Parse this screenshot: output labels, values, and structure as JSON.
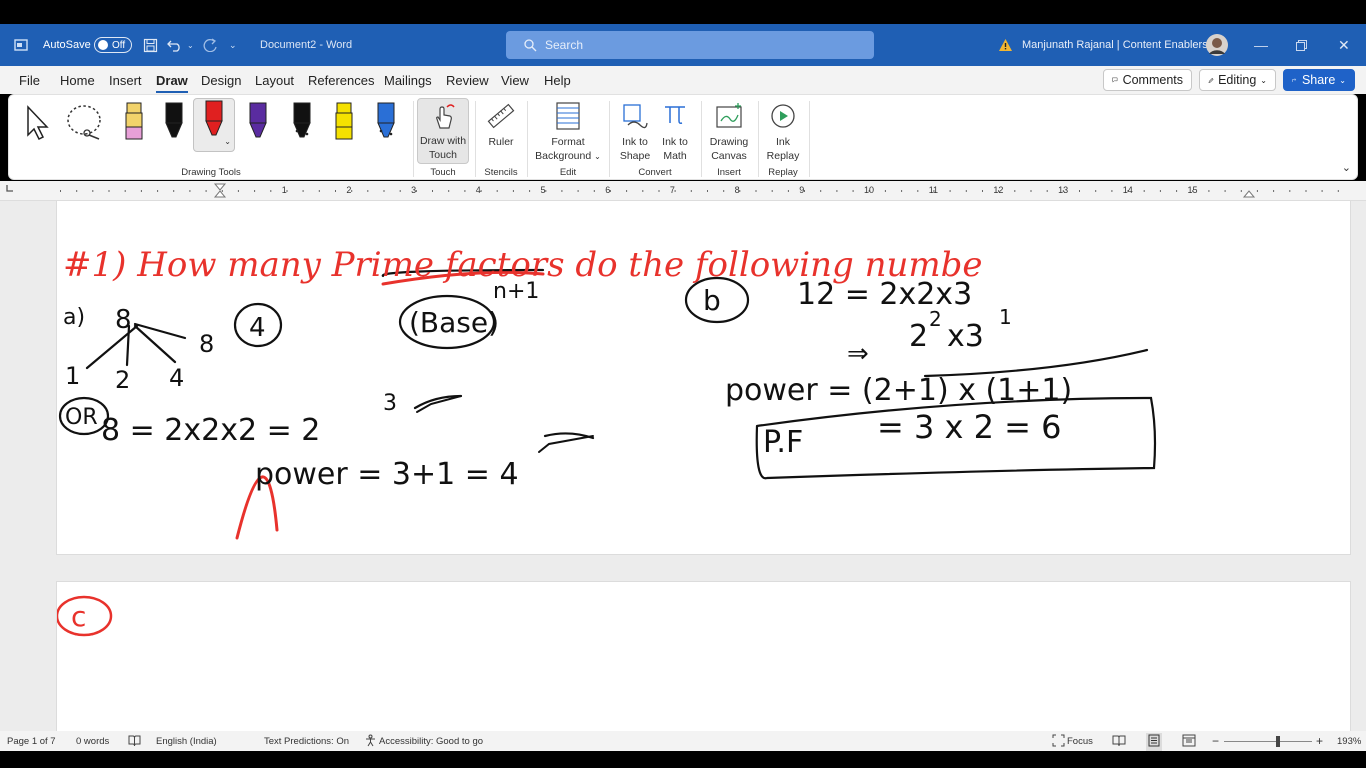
{
  "titlebar": {
    "autosave_label": "AutoSave",
    "autosave_state": "Off",
    "doc_title": "Document2",
    "separator": "-",
    "app_name": "Word",
    "search_placeholder": "Search",
    "user": "Manjunath Rajanal | Content Enablers"
  },
  "menu": {
    "items": [
      "File",
      "Home",
      "Insert",
      "Draw",
      "Design",
      "Layout",
      "References",
      "Mailings",
      "Review",
      "View",
      "Help"
    ],
    "active": "Draw",
    "comments": "Comments",
    "editing": "Editing",
    "share": "Share"
  },
  "ribbon": {
    "groups": {
      "drawing_tools": "Drawing Tools",
      "touch": "Touch",
      "stencils": "Stencils",
      "edit": "Edit",
      "convert": "Convert",
      "insert": "Insert",
      "replay": "Replay"
    },
    "buttons": {
      "draw_with_touch_1": "Draw with",
      "draw_with_touch_2": "Touch",
      "ruler": "Ruler",
      "format_bg_1": "Format",
      "format_bg_2": "Background",
      "ink_shape_1": "Ink to",
      "ink_shape_2": "Shape",
      "ink_math_1": "Ink to",
      "ink_math_2": "Math",
      "drawing_canvas_1": "Drawing",
      "drawing_canvas_2": "Canvas",
      "ink_replay_1": "Ink",
      "ink_replay_2": "Replay"
    },
    "pens": [
      {
        "name": "highlighter-pink",
        "color": "#e8a0d8",
        "tip": "#f2d36b"
      },
      {
        "name": "pen-black",
        "color": "#111111",
        "tip": "#111111"
      },
      {
        "name": "pen-red",
        "color": "#e02020",
        "tip": "#e02020"
      },
      {
        "name": "pen-purple",
        "color": "#5a2ca0",
        "tip": "#5a2ca0"
      },
      {
        "name": "pen-black-glitter",
        "color": "#111111",
        "tip": "#111111"
      },
      {
        "name": "highlighter-yellow",
        "color": "#f5e100",
        "tip": "#f5e100"
      },
      {
        "name": "pen-blue-glitter",
        "color": "#2a6fd6",
        "tip": "#2a6fd6"
      }
    ]
  },
  "ruler": {
    "numbers": [
      "1",
      "2",
      "3",
      "4",
      "5",
      "6",
      "7",
      "8",
      "9",
      "10",
      "11",
      "12",
      "13",
      "14",
      "15"
    ]
  },
  "ink": {
    "heading": "#1) How many Prime factors do the following numbe",
    "base_label": "(Base)",
    "exponent": "n+1",
    "a_label": "a)",
    "a_num": "8",
    "a_count": "4",
    "factors": [
      "1",
      "2",
      "4",
      "8"
    ],
    "or_label": "OR",
    "a_expr": "8 = 2x2x2 = 2",
    "a_exp": "3",
    "a_power": "power = 3+1 = 4",
    "b_label": "b",
    "b_expr1": "12 = 2x2x3",
    "b_arrow": "⇒",
    "b_expr2a": "2",
    "b_expr2b": "x3",
    "b_sup1": "2",
    "b_sup2": "1",
    "b_power": "power = (2+1) x (1+1)",
    "b_pf": "P.F",
    "b_pf_value": "= 3 x 2 = 6",
    "c_label": "c",
    "ink_color": "#e8322c"
  },
  "status": {
    "page": "Page 1 of 7",
    "words": "0 words",
    "language": "English (India)",
    "predictions": "Text Predictions: On",
    "accessibility": "Accessibility: Good to go",
    "focus": "Focus",
    "zoom": "193%"
  }
}
